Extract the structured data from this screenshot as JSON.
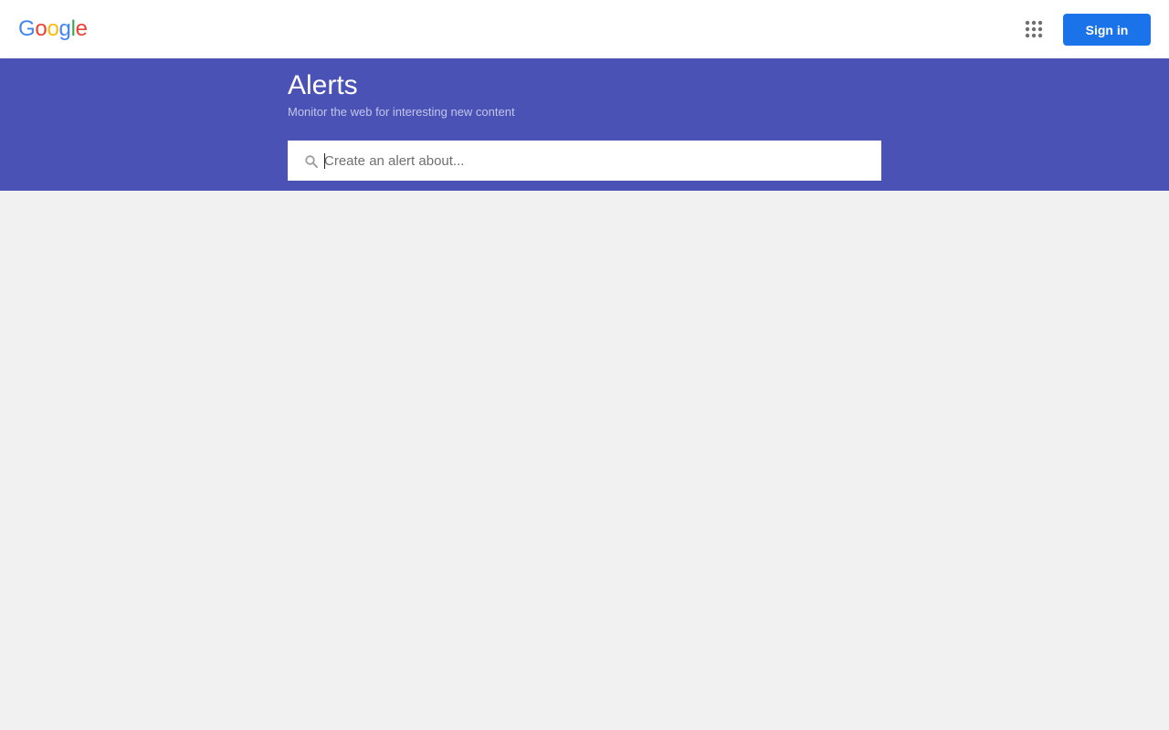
{
  "header": {
    "logo_letters": [
      {
        "char": "G",
        "color": "#4285F4"
      },
      {
        "char": "o",
        "color": "#EA4335"
      },
      {
        "char": "o",
        "color": "#FBBC05"
      },
      {
        "char": "g",
        "color": "#4285F4"
      },
      {
        "char": "l",
        "color": "#34A853"
      },
      {
        "char": "e",
        "color": "#EA4335"
      }
    ],
    "apps_icon": "apps-grid-icon",
    "signin_label": "Sign in"
  },
  "banner": {
    "title": "Alerts",
    "subtitle": "Monitor the web for interesting new content",
    "background_color": "#4a52b5"
  },
  "search": {
    "icon": "search-icon",
    "placeholder": "Create an alert about...",
    "value": ""
  },
  "colors": {
    "accent": "#1a73e8",
    "page_background": "#f1f1f1"
  }
}
